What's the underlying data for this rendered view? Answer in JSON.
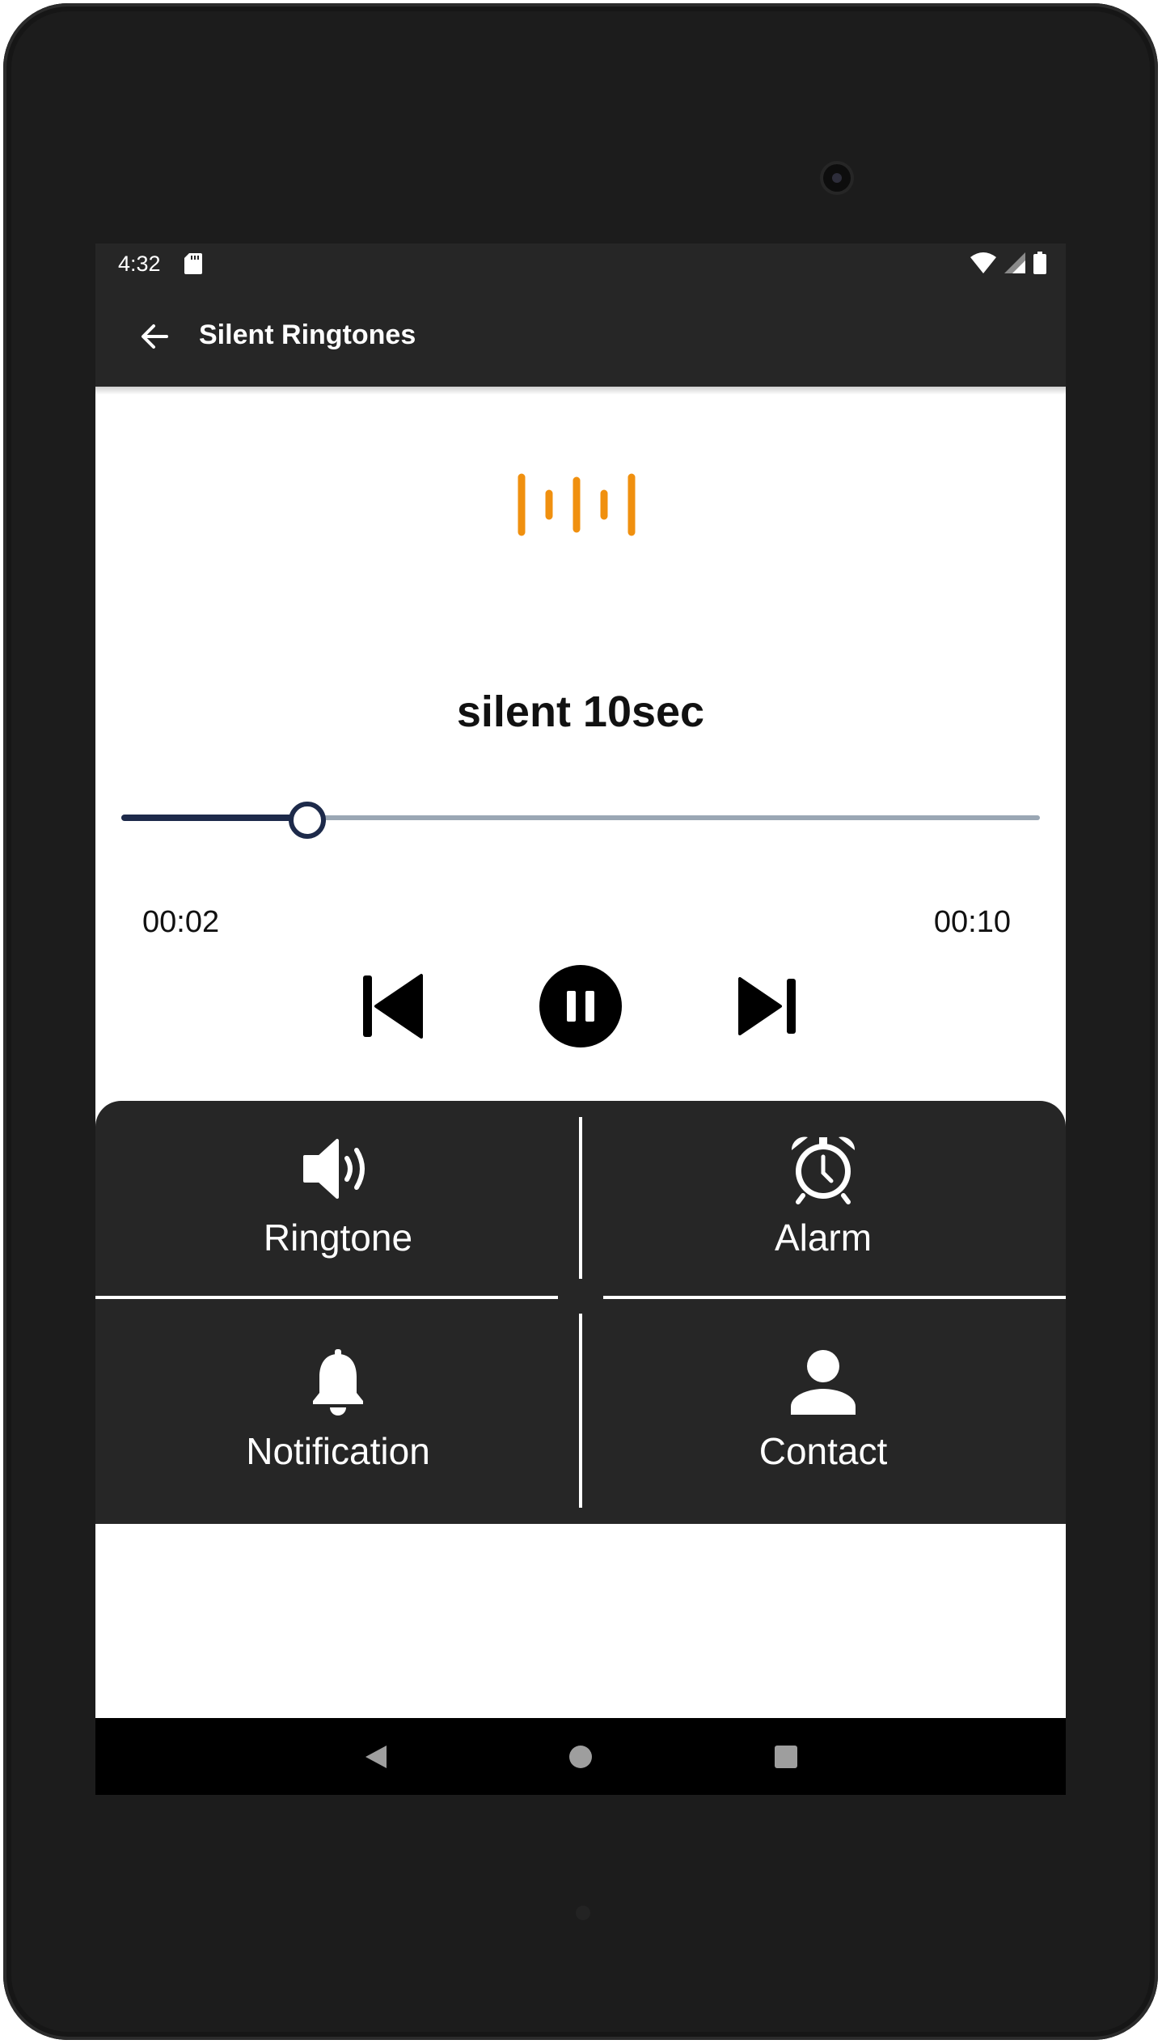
{
  "status_bar": {
    "time": "4:32",
    "icons": [
      "sd-card-icon",
      "wifi-icon",
      "signal-icon",
      "battery-icon"
    ]
  },
  "app_bar": {
    "title": "Silent Ringtones",
    "back_icon": "arrow-left-icon"
  },
  "player": {
    "waveform_icon": "waveform-icon",
    "accent_color": "#f0900f",
    "track_title": "silent 10sec",
    "current_time": "00:02",
    "total_time": "00:10",
    "progress_fraction": 0.2,
    "controls": [
      "skip-previous-icon",
      "pause-icon",
      "skip-next-icon"
    ]
  },
  "actions": {
    "ringtone_label": "Ringtone",
    "alarm_label": "Alarm",
    "notification_label": "Notification",
    "contact_label": "Contact"
  },
  "nav_bar": {
    "icons": [
      "nav-back-icon",
      "nav-home-icon",
      "nav-recents-icon"
    ]
  },
  "colors": {
    "bar_background": "#262626",
    "seek_fill": "#1d2a4a",
    "seek_track": "#9aa7b4"
  }
}
